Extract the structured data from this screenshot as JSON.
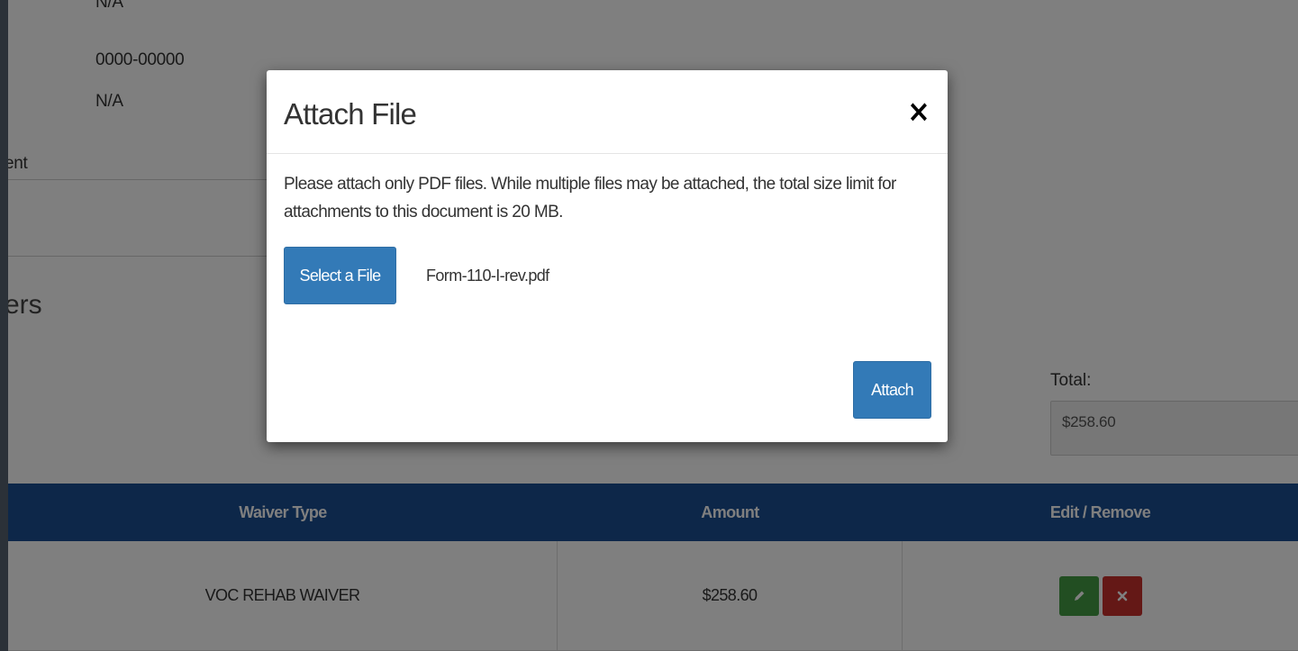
{
  "page": {
    "details": {
      "value_na_top": "N/A",
      "value_code": "0000-00000",
      "value_na": "N/A",
      "label_partial": "ent"
    },
    "section_title_partial": "ers",
    "total": {
      "label": "Total:",
      "value": "$258.60"
    },
    "table": {
      "headers": [
        "Waiver Type",
        "Amount",
        "Edit / Remove"
      ],
      "rows": [
        {
          "waiver_type": "VOC REHAB WAIVER",
          "amount": "$258.60"
        }
      ]
    },
    "icons": {
      "edit": "pencil-icon",
      "remove": "times-icon"
    },
    "colors": {
      "header": "#1b4f93",
      "edit": "#449d44",
      "remove": "#c9302c",
      "primary": "#337ab7"
    }
  },
  "modal": {
    "title": "Attach File",
    "close_label": "×",
    "message": "Please attach only PDF files. While multiple files may be attached, the total size limit for attachments to this document is 20 MB.",
    "select_button": "Select a File",
    "file_name": "Form-110-I-rev.pdf",
    "attach_button": "Attach"
  }
}
